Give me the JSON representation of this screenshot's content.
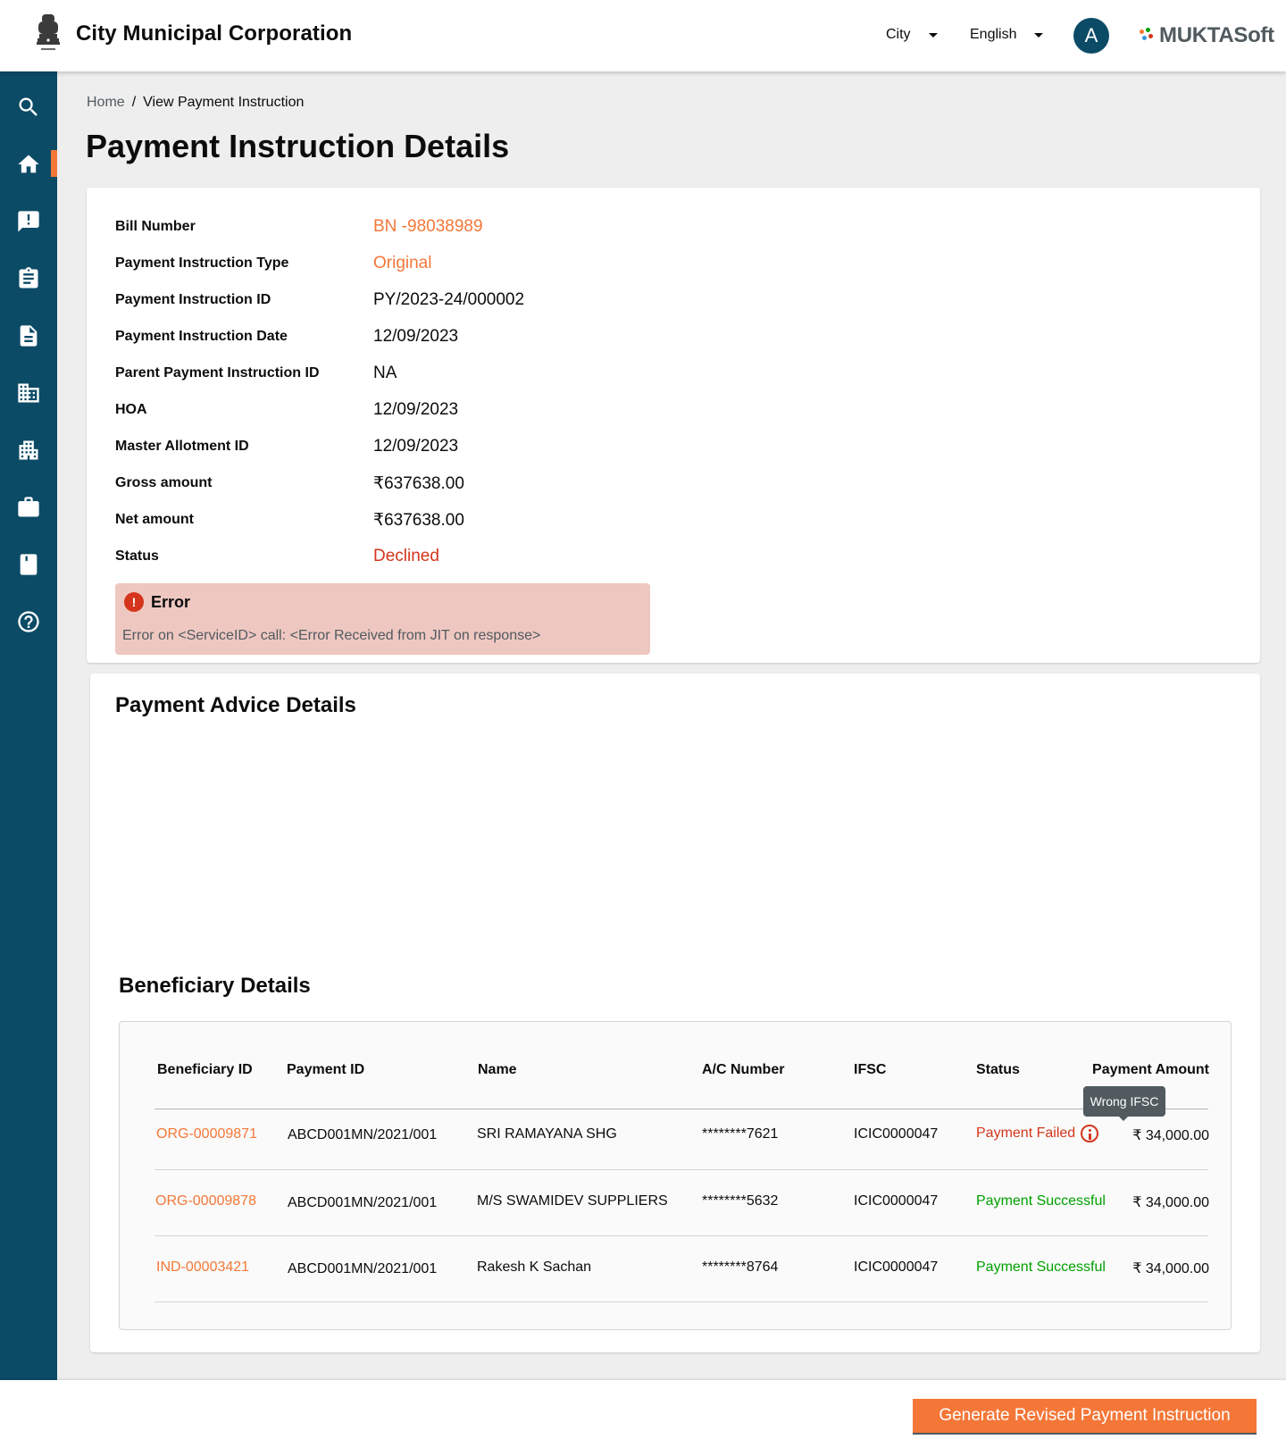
{
  "header": {
    "org_title": "City Municipal Corporation",
    "city_selector": "City",
    "language_selector": "English",
    "avatar_initial": "A",
    "brand": "MUKTASoft",
    "brand_dot_colors": [
      "#f47738",
      "#00a000",
      "#3498db",
      "#d4351c"
    ]
  },
  "sidebar": {
    "items": [
      {
        "icon": "search-icon"
      },
      {
        "icon": "home-icon",
        "active": true
      },
      {
        "icon": "complaint-icon"
      },
      {
        "icon": "clipboard-icon"
      },
      {
        "icon": "document-icon"
      },
      {
        "icon": "building-icon"
      },
      {
        "icon": "city-icon"
      },
      {
        "icon": "briefcase-icon"
      },
      {
        "icon": "bookmark-book-icon"
      },
      {
        "icon": "help-icon"
      }
    ],
    "active_color": "#f47738",
    "background": "#0b4b66"
  },
  "breadcrumb": {
    "home": "Home",
    "separator": "/",
    "current": "View Payment Instruction"
  },
  "page_title": "Payment Instruction Details",
  "details": [
    {
      "label": "Bill Number",
      "value": "BN -98038989",
      "style": "orange"
    },
    {
      "label": "Payment Instruction Type",
      "value": "Original",
      "style": "orange"
    },
    {
      "label": "Payment  Instruction ID",
      "value": "PY/2023-24/000002",
      "style": "normal"
    },
    {
      "label": "Payment  Instruction Date",
      "value": "12/09/2023",
      "style": "normal"
    },
    {
      "label": "Parent Payment  Instruction ID",
      "value": "NA",
      "style": "normal"
    },
    {
      "label": "HOA",
      "value": "12/09/2023",
      "style": "normal"
    },
    {
      "label": "Master Allotment ID",
      "value": "12/09/2023",
      "style": "normal"
    },
    {
      "label": "Gross amount",
      "value": "₹637638.00",
      "style": "normal"
    },
    {
      "label": "Net amount",
      "value": "₹637638.00",
      "style": "normal"
    },
    {
      "label": "Status",
      "value": "Declined",
      "style": "red"
    }
  ],
  "error": {
    "icon": "!",
    "title": "Error",
    "message": "Error on <ServiceID> call: <Error Received from JIT on response>"
  },
  "advice_section_title": "Payment Advice Details",
  "beneficiary_section_title": "Beneficiary Details",
  "table": {
    "headers": [
      "Beneficiary ID",
      "Payment ID",
      "Name",
      "A/C Number",
      "IFSC",
      "Status",
      "Payment Amount"
    ],
    "rows": [
      {
        "beneficiary_id": "ORG-00009871",
        "payment_id": "ABCD001MN/2021/001",
        "name": "SRI RAMAYANA SHG",
        "ac_number": "********7621",
        "ifsc": "ICIC0000047",
        "status": "Payment Failed",
        "status_type": "failed",
        "amount": "₹ 34,000.00"
      },
      {
        "beneficiary_id": "ORG-00009878",
        "payment_id": "ABCD001MN/2021/001",
        "name": "M/S SWAMIDEV  SUPPLIERS",
        "ac_number": "********5632",
        "ifsc": "ICIC0000047",
        "status": "Payment Successful",
        "status_type": "success",
        "amount": "₹ 34,000.00"
      },
      {
        "beneficiary_id": "IND-00003421",
        "payment_id": "ABCD001MN/2021/001",
        "name": "Rakesh K Sachan",
        "ac_number": "********8764",
        "ifsc": "ICIC0000047",
        "status": "Payment Successful",
        "status_type": "success",
        "amount": "₹ 34,000.00"
      }
    ],
    "tooltip": "Wrong IFSC"
  },
  "footer": {
    "primary_button": "Generate Revised Payment Instruction"
  },
  "colors": {
    "accent": "#f47738",
    "error": "#d4351c",
    "success": "#00a000",
    "primary_dark": "#0b4b66"
  }
}
